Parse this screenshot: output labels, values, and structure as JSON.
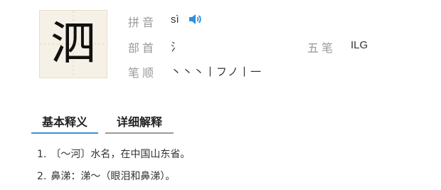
{
  "character": {
    "glyph": "泗"
  },
  "info": {
    "pinyin_label": "拼音",
    "pinyin_value": "sì",
    "radical_label": "部首",
    "radical_value": "氵",
    "wubi_label": "五笔",
    "wubi_value": "ILG",
    "strokes_label": "笔顺",
    "strokes_value": "丶丶丶丨フノ丨一"
  },
  "tabs": [
    {
      "label": "基本释义",
      "active": true
    },
    {
      "label": "详细解释",
      "active": false
    }
  ],
  "definitions": [
    {
      "num": "1.",
      "text": "〔～河〕水名，在中国山东省。"
    },
    {
      "num": "2.",
      "text": "鼻涕：涕～（眼泪和鼻涕）。"
    }
  ],
  "colors": {
    "tab_active_underline": "#3a92d8",
    "tab_inactive_underline": "#9a9a9a",
    "audio_icon": "#2d8fe0",
    "tile_bg": "#f6f1e6"
  },
  "icons": {
    "audio": "speaker-icon"
  }
}
